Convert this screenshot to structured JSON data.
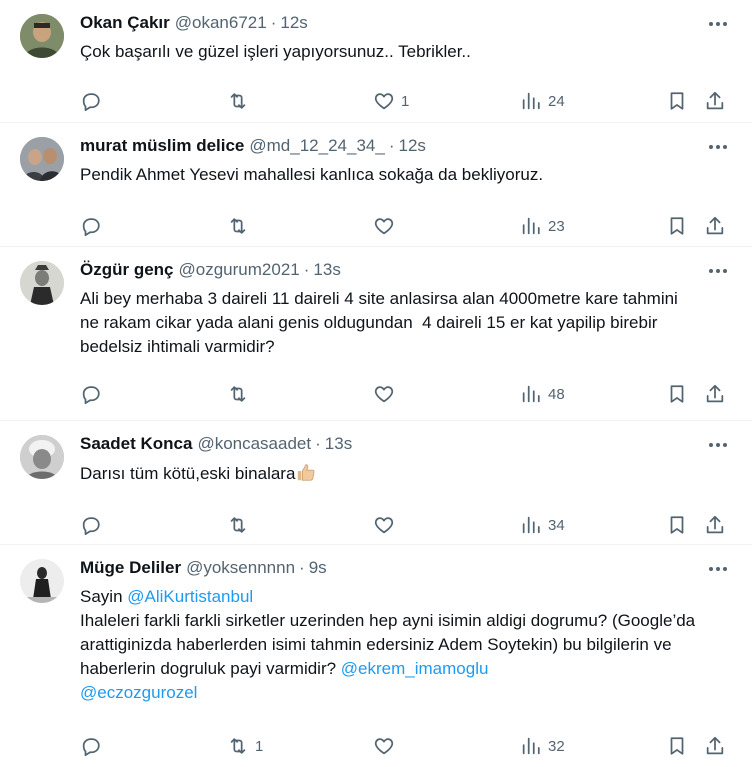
{
  "tweets": [
    {
      "name": "Okan Çakır",
      "handle": "@okan6721",
      "dot": "·",
      "time": "12s",
      "text": "Çok başarılı ve güzel işleri yapıyorsunuz.. Tebrikler..",
      "replies": "",
      "retweets": "",
      "likes": "1",
      "views": "24",
      "avatar_colors": [
        "#6b7a5a",
        "#3e4a34",
        "#c9a27e"
      ]
    },
    {
      "name": "murat müslim delice",
      "handle": "@md_12_24_34_",
      "dot": "·",
      "time": "12s",
      "text": "Pendik Ahmet Yesevi mahallesi kanlıca sokağa da bekliyoruz.",
      "replies": "",
      "retweets": "",
      "likes": "",
      "views": "23",
      "avatar_colors": [
        "#8b8f93",
        "#3a3d42",
        "#c8a58a"
      ]
    },
    {
      "name": "Özgür genç",
      "handle": "@ozgurum2021",
      "dot": "·",
      "time": "13s",
      "text": "Ali bey merhaba 3 daireli 11 daireli 4 site anlasirsa alan 4000metre kare tahmini ne rakam cikar yada alani genis oldugundan  4 daireli 15 er kat yapilip birebir bedelsiz ihtimali varmidir?",
      "replies": "",
      "retweets": "",
      "likes": "",
      "views": "48",
      "avatar_colors": [
        "#d7d7d2",
        "#2b2b2b",
        "#7d7d78"
      ]
    },
    {
      "name": "Saadet Konca",
      "handle": "@koncasaadet",
      "dot": "·",
      "time": "13s",
      "text_before_emoji": "Darısı tüm kötü,eski binalara",
      "emoji": "thumbs-up",
      "replies": "",
      "retweets": "",
      "likes": "",
      "views": "34",
      "avatar_colors": [
        "#bfbfbf",
        "#f2f2f2",
        "#6d6d6d"
      ]
    },
    {
      "name": "Müge Deliler",
      "handle": "@yoksennnnn",
      "dot": "·",
      "time": "9s",
      "line1_prefix": "Sayin ",
      "line1_mention": "@AliKurtistanbul",
      "body": "Ihaleleri farkli farkli sirketler uzerinden hep ayni isimin aldigi dogrumu? (Google’da arattiginizda haberlerden isimi tahmin edersiniz Adem Soytekin) bu bilgilerin ve haberlerin dogruluk payi varmidir? ",
      "mention2": "@ekrem_imamoglu",
      "mention3": "@eczozgurozel",
      "replies": "",
      "retweets": "1",
      "likes": "",
      "views": "32",
      "avatar_colors": [
        "#f3f3f3",
        "#1f1f1f",
        "#9a9a9a"
      ]
    }
  ],
  "icons": {
    "more": "more-dots-icon",
    "reply": "reply-icon",
    "retweet": "retweet-icon",
    "like": "heart-icon",
    "views": "views-chart-icon",
    "bookmark": "bookmark-icon",
    "share": "share-icon"
  }
}
